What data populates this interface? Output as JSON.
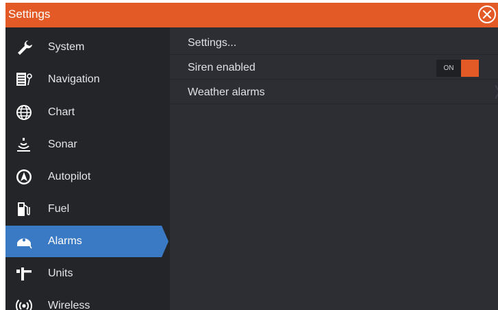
{
  "window": {
    "title": "Settings",
    "accent_color": "#e35a26",
    "selection_color": "#3a7ac4"
  },
  "sidebar": {
    "items": [
      {
        "label": "System",
        "icon": "wrench-icon"
      },
      {
        "label": "Navigation",
        "icon": "navigation-icon"
      },
      {
        "label": "Chart",
        "icon": "globe-icon"
      },
      {
        "label": "Sonar",
        "icon": "sonar-icon"
      },
      {
        "label": "Autopilot",
        "icon": "autopilot-icon"
      },
      {
        "label": "Fuel",
        "icon": "fuel-pump-icon"
      },
      {
        "label": "Alarms",
        "icon": "alarm-icon",
        "selected": true
      },
      {
        "label": "Units",
        "icon": "units-icon"
      },
      {
        "label": "Wireless",
        "icon": "wireless-icon"
      }
    ]
  },
  "content": {
    "rows": [
      {
        "label": "Settings..."
      },
      {
        "label": "Siren enabled",
        "toggle": {
          "state_label": "ON",
          "on": true
        }
      },
      {
        "label": "Weather alarms",
        "has_submenu": true
      }
    ]
  }
}
